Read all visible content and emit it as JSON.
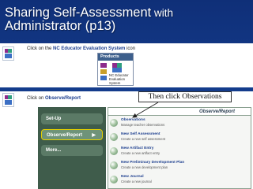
{
  "slide": {
    "title_part1": "Sharing Self-Assessment",
    "title_part2": " with",
    "title_line2": "Administrator (p13)"
  },
  "step1": {
    "instruction_prefix": "Click on the ",
    "instruction_link": "NC Educator Evaluation System",
    "instruction_suffix": " icon",
    "products_header": "Products",
    "product_label": "NC Educator Evaluation System",
    "product_label_line1": "NC Educator",
    "product_label_line2": "Evaluation System"
  },
  "step2": {
    "instruction_prefix": "Click on ",
    "instruction_bold": "Observe/Report",
    "callout": "Then click Observations",
    "sidebar_items": [
      {
        "label": "Set-Up"
      },
      {
        "label": "Observe/Report",
        "active": true
      },
      {
        "label": "More..."
      }
    ],
    "panel_header": "Observe/Report",
    "entries": [
      {
        "title": "Observations",
        "desc": "Manage teacher observations"
      },
      {
        "title": "New Self Assessment",
        "desc": "Create a new self assessment"
      },
      {
        "title": "New Artifact Entry",
        "desc": "Create a new artifact entry"
      },
      {
        "title": "New Preliminary Development Plan",
        "desc": "Create a new development plan"
      },
      {
        "title": "New Journal",
        "desc": "Create a new journal"
      }
    ]
  },
  "colors": {
    "background": "#1a4aa2",
    "callout_border": "#333333",
    "arrow_fill": "#ffff33",
    "sidebar_bg": "#3f5c4b",
    "active_border": "#e4d000"
  },
  "icons": {
    "app_logo": "nc-educator-logo-icon",
    "arrow": "pointer-arrow-icon",
    "entry_icon": "globe-icon"
  }
}
